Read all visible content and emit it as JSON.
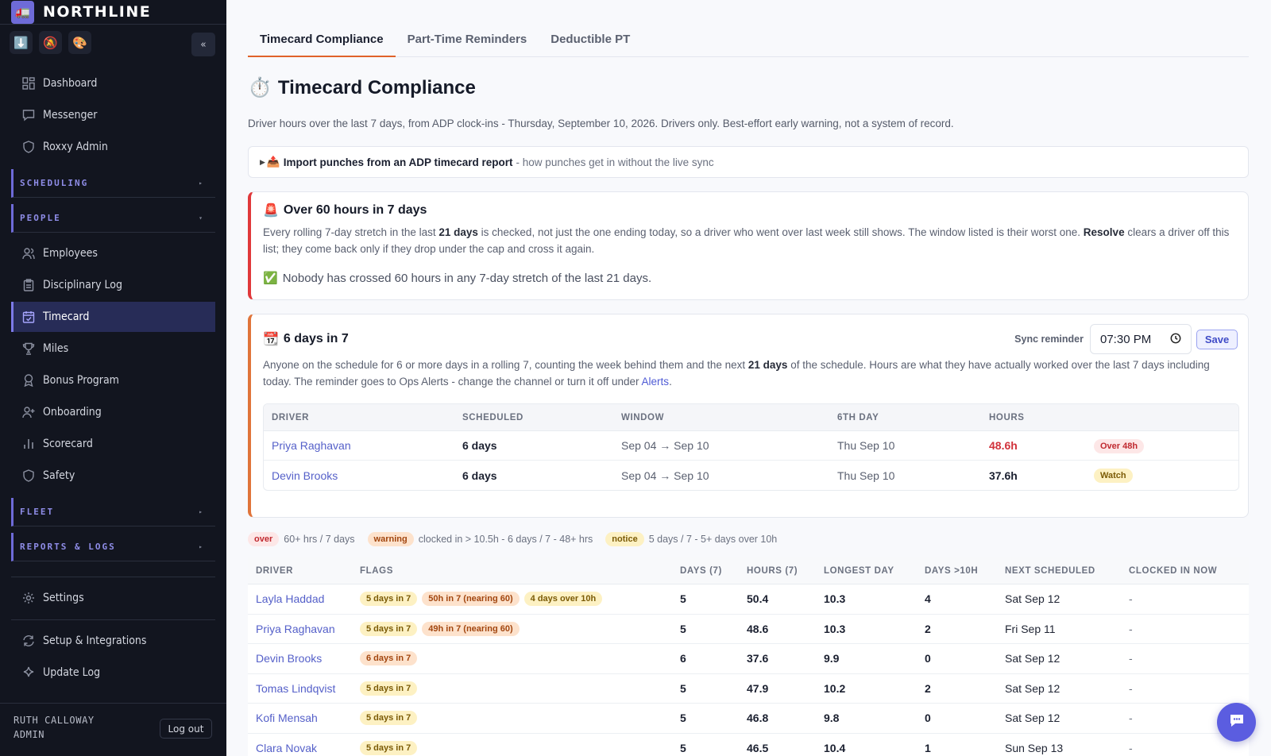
{
  "app": {
    "name": "NORTHLINE",
    "logo_emoji": "🚛"
  },
  "quickbar": {
    "icons": [
      "⬇️",
      "🔕",
      "🎨"
    ],
    "collapse": "«"
  },
  "nav": {
    "dashboard": "Dashboard",
    "messenger": "Messenger",
    "roxxy": "Roxxy Admin",
    "scheduling": "SCHEDULING",
    "people": "PEOPLE",
    "employees": "Employees",
    "disciplinary": "Disciplinary Log",
    "timecard": "Timecard",
    "miles": "Miles",
    "bonus": "Bonus Program",
    "onboarding": "Onboarding",
    "scorecard": "Scorecard",
    "safety": "Safety",
    "fleet": "FLEET",
    "reports": "REPORTS & LOGS",
    "settings": "Settings",
    "setup": "Setup & Integrations",
    "update_log": "Update Log"
  },
  "user": {
    "name": "RUTH CALLOWAY",
    "role": "ADMIN",
    "logout": "Log out"
  },
  "tabs": [
    "Timecard Compliance",
    "Part-Time Reminders",
    "Deductible PT"
  ],
  "page": {
    "icon": "⏱️",
    "title": "Timecard Compliance",
    "subtitle": "Driver hours over the last 7 days, from ADP clock-ins - Thursday, September 10, 2026. Drivers only. Best-effort early warning, not a system of record."
  },
  "import": {
    "arrow": "▶",
    "icon": "📤",
    "title": "Import punches from an ADP timecard report",
    "rest": "- how punches get in without the live sync"
  },
  "over60": {
    "icon": "🚨",
    "title": "Over 60 hours in 7 days",
    "text_a": "Every rolling 7-day stretch in the last ",
    "text_b": "21 days",
    "text_c": " is checked, not just the one ending today, so a driver who went over last week still shows. The window listed is their worst one. ",
    "text_d": "Resolve",
    "text_e": " clears a driver off this list; they come back only if they drop under the cap and cross it again.",
    "ok_icon": "✅",
    "ok": "Nobody has crossed 60 hours in any 7-day stretch of the last 21 days."
  },
  "six_days": {
    "icon": "📆",
    "title": "6 days in 7",
    "sync_label": "Sync reminder",
    "time": "07:30 PM",
    "save": "Save",
    "text_a": "Anyone on the schedule for 6 or more days in a rolling 7, counting the week behind them and the next ",
    "text_b": "21 days",
    "text_c": " of the schedule. Hours are what they have actually worked over the last 7 days including today. The reminder goes to Ops Alerts - change the channel or turn it off under ",
    "text_link": "Alerts",
    "text_d": ".",
    "headers": [
      "DRIVER",
      "SCHEDULED",
      "WINDOW",
      "6TH DAY",
      "HOURS"
    ],
    "rows": [
      {
        "driver": "Priya Raghavan",
        "scheduled": "6 days",
        "window": "Sep 04 → Sep 10",
        "sixth": "Thu Sep 10",
        "hours": "48.6h",
        "badge": "Over 48h"
      },
      {
        "driver": "Devin Brooks",
        "scheduled": "6 days",
        "window": "Sep 04 → Sep 10",
        "sixth": "Thu Sep 10",
        "hours": "37.6h",
        "badge": "Watch"
      }
    ]
  },
  "legend": [
    {
      "tag": "over",
      "text": "60+ hrs / 7 days"
    },
    {
      "tag": "warning",
      "text": "clocked in > 10.5h - 6 days / 7 - 48+ hrs"
    },
    {
      "tag": "notice",
      "text": "5 days / 7 - 5+ days over 10h"
    }
  ],
  "table": {
    "headers": [
      "DRIVER",
      "FLAGS",
      "DAYS (7)",
      "HOURS (7)",
      "LONGEST DAY",
      "DAYS >10H",
      "NEXT SCHEDULED",
      "CLOCKED IN NOW"
    ],
    "rows": [
      {
        "driver": "Layla Haddad",
        "flags": [
          "5 days in 7",
          "50h in 7 (nearing 60)",
          "4 days over 10h"
        ],
        "days": "5",
        "hours": "50.4",
        "longest": "10.3",
        "over10": "4",
        "next": "Sat Sep 12",
        "clocked": "-"
      },
      {
        "driver": "Priya Raghavan",
        "flags": [
          "5 days in 7",
          "49h in 7 (nearing 60)"
        ],
        "days": "5",
        "hours": "48.6",
        "longest": "10.3",
        "over10": "2",
        "next": "Fri Sep 11",
        "clocked": "-"
      },
      {
        "driver": "Devin Brooks",
        "flags": [
          "6 days in 7"
        ],
        "days": "6",
        "hours": "37.6",
        "longest": "9.9",
        "over10": "0",
        "next": "Sat Sep 12",
        "clocked": "-"
      },
      {
        "driver": "Tomas Lindqvist",
        "flags": [
          "5 days in 7"
        ],
        "days": "5",
        "hours": "47.9",
        "longest": "10.2",
        "over10": "2",
        "next": "Sat Sep 12",
        "clocked": "-"
      },
      {
        "driver": "Kofi Mensah",
        "flags": [
          "5 days in 7"
        ],
        "days": "5",
        "hours": "46.8",
        "longest": "9.8",
        "over10": "0",
        "next": "Sat Sep 12",
        "clocked": "-"
      },
      {
        "driver": "Clara Novak",
        "flags": [
          "5 days in 7"
        ],
        "days": "5",
        "hours": "46.5",
        "longest": "10.4",
        "over10": "1",
        "next": "Sun Sep 13",
        "clocked": "-"
      }
    ]
  },
  "colors": {
    "accent": "#6e6bd8",
    "danger": "#e0383a",
    "warning": "#e0743a"
  }
}
